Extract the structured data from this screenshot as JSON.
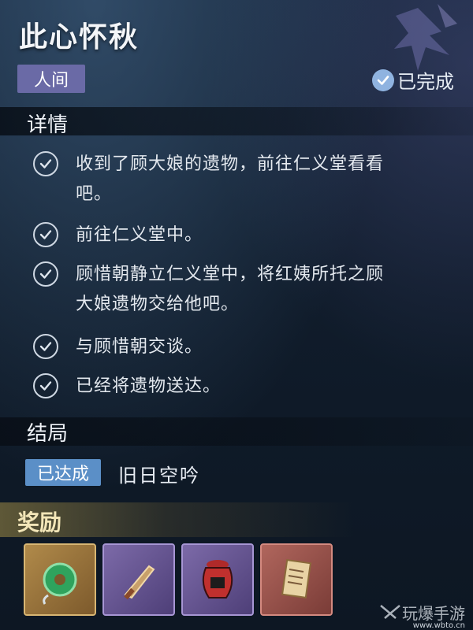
{
  "quest": {
    "title": "此心怀秋",
    "category": "人间",
    "status": "已完成"
  },
  "details": {
    "heading": "详情",
    "steps": [
      {
        "line1": "收到了顾大娘的遗物，前往仁义堂看看",
        "line2": "吧。"
      },
      {
        "line1": "前往仁义堂中。",
        "line2": ""
      },
      {
        "line1": "顾惜朝静立仁义堂中，将红姨所托之顾",
        "line2": "大娘遗物交给他吧。"
      },
      {
        "line1": "与顾惜朝交谈。",
        "line2": ""
      },
      {
        "line1": "已经将遗物送达。",
        "line2": ""
      }
    ]
  },
  "ending": {
    "heading": "结局",
    "badge": "已达成",
    "name": "旧日空吟"
  },
  "rewards": {
    "heading": "奖励",
    "items": [
      {
        "icon": "jade-pendant-icon",
        "rarity": "gold"
      },
      {
        "icon": "dagger-icon",
        "rarity": "purple"
      },
      {
        "icon": "red-jar-icon",
        "rarity": "purple"
      },
      {
        "icon": "letter-scroll-icon",
        "rarity": "red"
      }
    ]
  },
  "watermark": {
    "text": "玩爆手游",
    "url": "www.wbto.cn"
  },
  "colors": {
    "category_tag": "#6a6aa6",
    "ending_badge": "#5b8fc7",
    "reward_gold": "#b08a4a",
    "reward_purple": "#7c6aa8",
    "reward_red": "#b0665d"
  }
}
